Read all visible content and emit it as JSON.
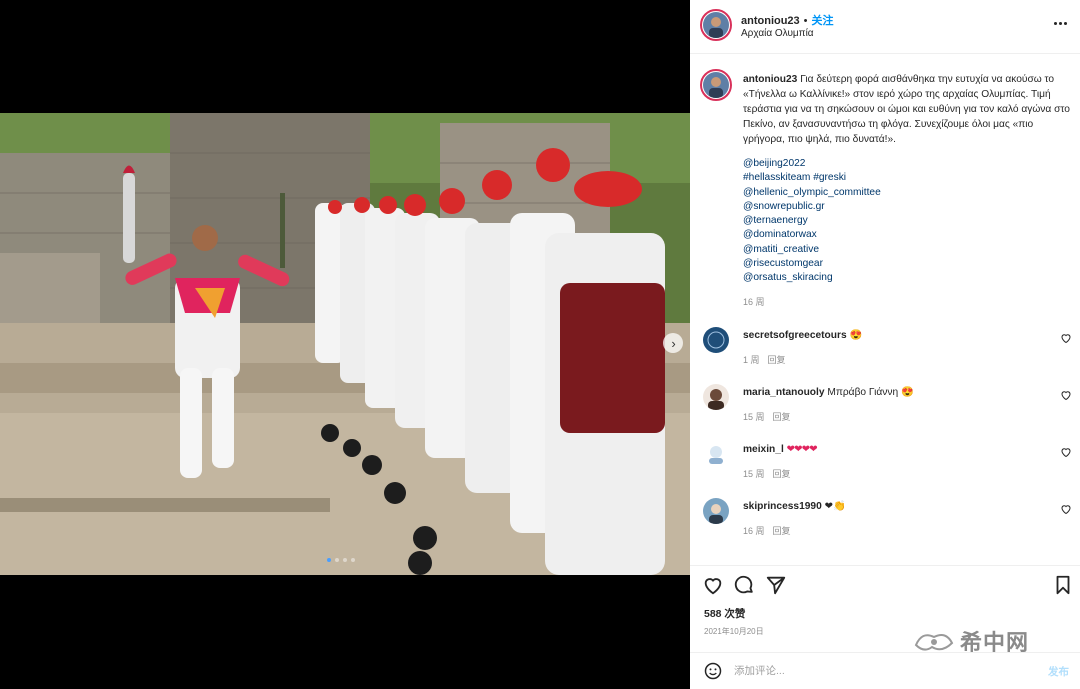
{
  "post": {
    "username": "antoniou23",
    "follow_label": "关注",
    "separator": "•",
    "location": "Αρχαία Ολυμπία"
  },
  "media": {
    "photo_desc": "torch-relay-photo",
    "slide_count": 4,
    "active_slide": 1
  },
  "caption": {
    "username": "antoniou23",
    "text": "Για δεύτερη φορά αισθάνθηκα την ευτυχία να ακούσω το «Τήνελλα ω Καλλίνικε!» στον ιερό χώρο της αρχαίας Ολυμπίας. Τιμή τεράστια για να τη σηκώσουν οι ώμοι και ευθύνη για τον καλό αγώνα στο Πεκίνο, αν ξανασυναντήσω τη φλόγα. Συνεχίζουμε όλοι μας «πιο γρήγορα, πιο ψηλά, πιο δυνατά!».",
    "tags": [
      "@beijing2022",
      "#hellasskiteam #greski",
      "@hellenic_olympic_committee",
      "@snowrepublic.gr",
      "@ternaenergy",
      "@dominatorwax",
      "@matiti_creative",
      "@risecustomgear",
      "@orsatus_skiracing"
    ],
    "time": "16 周"
  },
  "comments": [
    {
      "username": "secretsofgreecetours",
      "text": "",
      "emoji": "😍",
      "time": "1 周",
      "reply": "回复",
      "avatar_color": "#1f4e79"
    },
    {
      "username": "maria_ntanouoly",
      "text": "Μπράβο Γιάννη",
      "emoji": "😍",
      "time": "15 周",
      "reply": "回复",
      "avatar_color": "#6b4a3a"
    },
    {
      "username": "meixin_l",
      "text": "",
      "emoji": "❤❤❤❤",
      "time": "15 周",
      "reply": "回复",
      "avatar_color": "#d8e6f2"
    },
    {
      "username": "skiprincess1990",
      "text": "",
      "emoji": "❤👏",
      "time": "16 周",
      "reply": "回复",
      "avatar_color": "#7aa3c2"
    }
  ],
  "engagement": {
    "likes": "588 次赞",
    "date": "2021年10月20日"
  },
  "watermark": {
    "text": "希中网"
  },
  "add_comment": {
    "placeholder": "添加评论...",
    "post_label": "发布"
  },
  "colors": {
    "link": "#00376b",
    "follow": "#0095f6",
    "story_ring": "#d9305a",
    "heart": "#e0245e"
  }
}
